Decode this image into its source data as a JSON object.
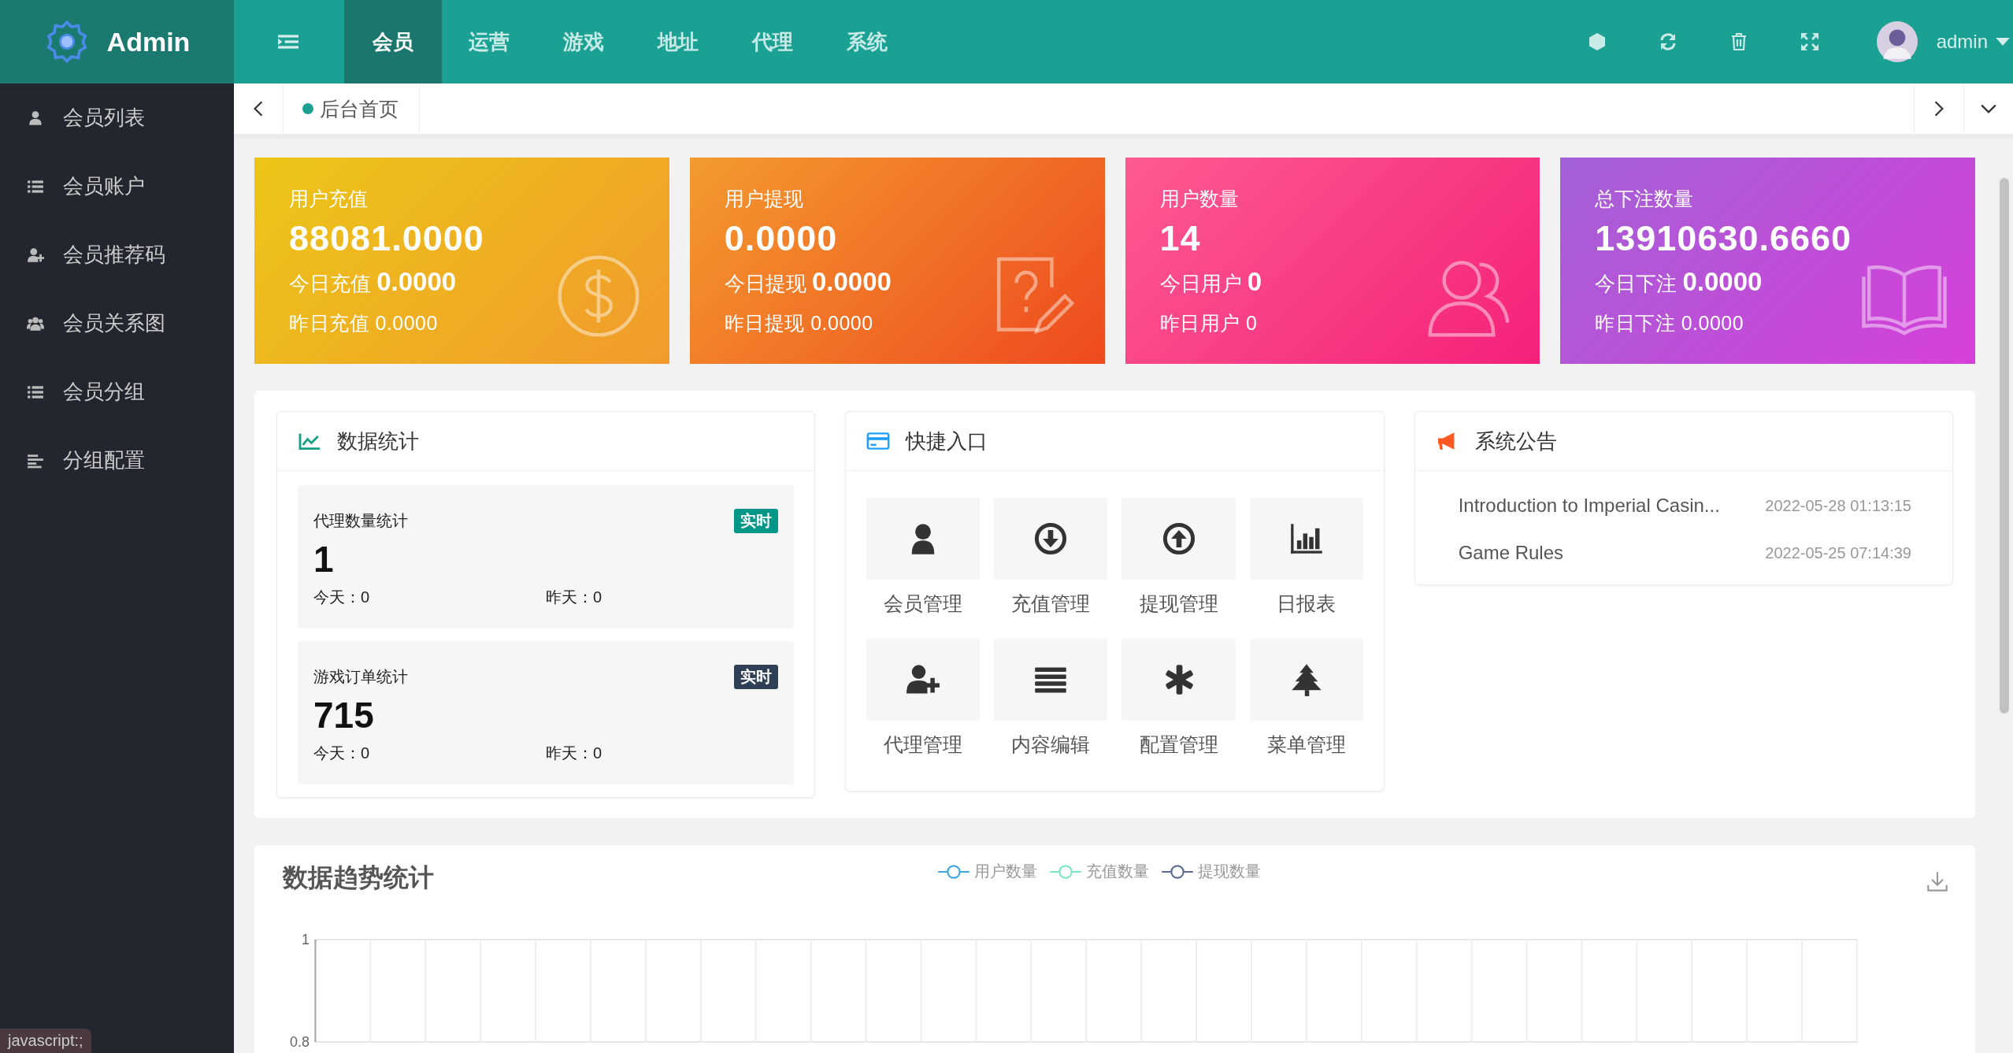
{
  "brand": {
    "name": "Admin"
  },
  "top_nav": [
    {
      "label": "会员",
      "selected": true
    },
    {
      "label": "运营",
      "selected": false
    },
    {
      "label": "游戏",
      "selected": false
    },
    {
      "label": "地址",
      "selected": false
    },
    {
      "label": "代理",
      "selected": false
    },
    {
      "label": "系统",
      "selected": false
    }
  ],
  "user": {
    "name": "admin"
  },
  "sidebar": {
    "items": [
      {
        "label": "会员列表"
      },
      {
        "label": "会员账户"
      },
      {
        "label": "会员推荐码"
      },
      {
        "label": "会员关系图"
      },
      {
        "label": "会员分组"
      },
      {
        "label": "分组配置"
      }
    ]
  },
  "breadcrumb": [
    {
      "label": "后台首页",
      "selected": true
    }
  ],
  "stat_cards": [
    {
      "title": "用户充值",
      "value": "88081.0000",
      "today_label": "今日充值",
      "today_value": "0.0000",
      "yesterday": "昨日充值 0.0000"
    },
    {
      "title": "用户提现",
      "value": "0.0000",
      "today_label": "今日提现",
      "today_value": "0.0000",
      "yesterday": "昨日提现 0.0000"
    },
    {
      "title": "用户数量",
      "value": "14",
      "today_label": "今日用户",
      "today_value": "0",
      "yesterday": "昨日用户 0"
    },
    {
      "title": "总下注数量",
      "value": "13910630.6660",
      "today_label": "今日下注",
      "today_value": "0.0000",
      "yesterday": "昨日下注 0.0000"
    }
  ],
  "data_stats": {
    "title": "数据统计",
    "items": [
      {
        "title": "代理数量统计",
        "badge": "实时",
        "color": "#009688",
        "value": "1",
        "today": "今天：0",
        "yesterday": "昨天：0"
      },
      {
        "title": "游戏订单统计",
        "badge": "实时",
        "color": "#2f4056",
        "value": "715",
        "today": "今天：0",
        "yesterday": "昨天：0"
      }
    ]
  },
  "shortcuts": {
    "title": "快捷入口",
    "items": [
      {
        "label": "会员管理"
      },
      {
        "label": "充值管理"
      },
      {
        "label": "提现管理"
      },
      {
        "label": "日报表"
      },
      {
        "label": "代理管理"
      },
      {
        "label": "内容编辑"
      },
      {
        "label": "配置管理"
      },
      {
        "label": "菜单管理"
      }
    ]
  },
  "notices": {
    "title": "系统公告",
    "items": [
      {
        "title": "Introduction to Imperial Casin...",
        "date": "2022-05-28 01:13:15"
      },
      {
        "title": "Game Rules",
        "date": "2022-05-25 07:14:39"
      }
    ]
  },
  "trend": {
    "title": "数据趋势统计",
    "chart_data": {
      "type": "line",
      "series": [
        {
          "name": "用户数量",
          "color": "#3fa7dc"
        },
        {
          "name": "充值数量",
          "color": "#7ee7c1"
        },
        {
          "name": "提现数量",
          "color": "#5c6b91"
        }
      ],
      "ylim": [
        0.8,
        1
      ],
      "yticks": [
        1,
        0.8
      ]
    }
  },
  "status_bar": "javascript:;"
}
